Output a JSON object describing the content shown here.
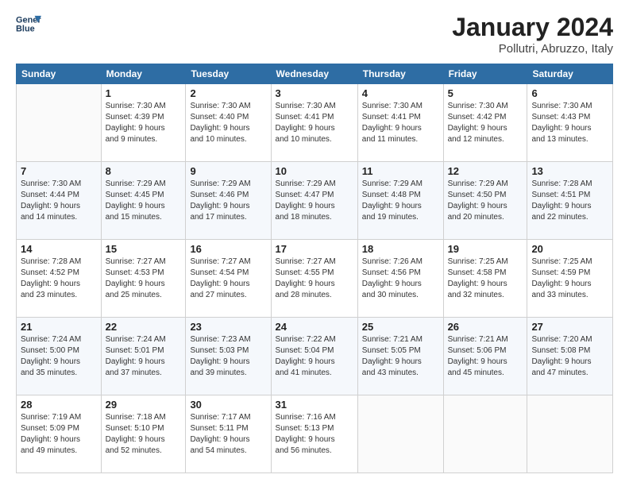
{
  "logo": {
    "line1": "General",
    "line2": "Blue"
  },
  "title": "January 2024",
  "location": "Pollutri, Abruzzo, Italy",
  "weekdays": [
    "Sunday",
    "Monday",
    "Tuesday",
    "Wednesday",
    "Thursday",
    "Friday",
    "Saturday"
  ],
  "weeks": [
    [
      {
        "day": "",
        "sunrise": "",
        "sunset": "",
        "daylight": ""
      },
      {
        "day": "1",
        "sunrise": "Sunrise: 7:30 AM",
        "sunset": "Sunset: 4:39 PM",
        "daylight": "Daylight: 9 hours and 9 minutes."
      },
      {
        "day": "2",
        "sunrise": "Sunrise: 7:30 AM",
        "sunset": "Sunset: 4:40 PM",
        "daylight": "Daylight: 9 hours and 10 minutes."
      },
      {
        "day": "3",
        "sunrise": "Sunrise: 7:30 AM",
        "sunset": "Sunset: 4:41 PM",
        "daylight": "Daylight: 9 hours and 10 minutes."
      },
      {
        "day": "4",
        "sunrise": "Sunrise: 7:30 AM",
        "sunset": "Sunset: 4:41 PM",
        "daylight": "Daylight: 9 hours and 11 minutes."
      },
      {
        "day": "5",
        "sunrise": "Sunrise: 7:30 AM",
        "sunset": "Sunset: 4:42 PM",
        "daylight": "Daylight: 9 hours and 12 minutes."
      },
      {
        "day": "6",
        "sunrise": "Sunrise: 7:30 AM",
        "sunset": "Sunset: 4:43 PM",
        "daylight": "Daylight: 9 hours and 13 minutes."
      }
    ],
    [
      {
        "day": "7",
        "sunrise": "Sunrise: 7:30 AM",
        "sunset": "Sunset: 4:44 PM",
        "daylight": "Daylight: 9 hours and 14 minutes."
      },
      {
        "day": "8",
        "sunrise": "Sunrise: 7:29 AM",
        "sunset": "Sunset: 4:45 PM",
        "daylight": "Daylight: 9 hours and 15 minutes."
      },
      {
        "day": "9",
        "sunrise": "Sunrise: 7:29 AM",
        "sunset": "Sunset: 4:46 PM",
        "daylight": "Daylight: 9 hours and 17 minutes."
      },
      {
        "day": "10",
        "sunrise": "Sunrise: 7:29 AM",
        "sunset": "Sunset: 4:47 PM",
        "daylight": "Daylight: 9 hours and 18 minutes."
      },
      {
        "day": "11",
        "sunrise": "Sunrise: 7:29 AM",
        "sunset": "Sunset: 4:48 PM",
        "daylight": "Daylight: 9 hours and 19 minutes."
      },
      {
        "day": "12",
        "sunrise": "Sunrise: 7:29 AM",
        "sunset": "Sunset: 4:50 PM",
        "daylight": "Daylight: 9 hours and 20 minutes."
      },
      {
        "day": "13",
        "sunrise": "Sunrise: 7:28 AM",
        "sunset": "Sunset: 4:51 PM",
        "daylight": "Daylight: 9 hours and 22 minutes."
      }
    ],
    [
      {
        "day": "14",
        "sunrise": "Sunrise: 7:28 AM",
        "sunset": "Sunset: 4:52 PM",
        "daylight": "Daylight: 9 hours and 23 minutes."
      },
      {
        "day": "15",
        "sunrise": "Sunrise: 7:27 AM",
        "sunset": "Sunset: 4:53 PM",
        "daylight": "Daylight: 9 hours and 25 minutes."
      },
      {
        "day": "16",
        "sunrise": "Sunrise: 7:27 AM",
        "sunset": "Sunset: 4:54 PM",
        "daylight": "Daylight: 9 hours and 27 minutes."
      },
      {
        "day": "17",
        "sunrise": "Sunrise: 7:27 AM",
        "sunset": "Sunset: 4:55 PM",
        "daylight": "Daylight: 9 hours and 28 minutes."
      },
      {
        "day": "18",
        "sunrise": "Sunrise: 7:26 AM",
        "sunset": "Sunset: 4:56 PM",
        "daylight": "Daylight: 9 hours and 30 minutes."
      },
      {
        "day": "19",
        "sunrise": "Sunrise: 7:25 AM",
        "sunset": "Sunset: 4:58 PM",
        "daylight": "Daylight: 9 hours and 32 minutes."
      },
      {
        "day": "20",
        "sunrise": "Sunrise: 7:25 AM",
        "sunset": "Sunset: 4:59 PM",
        "daylight": "Daylight: 9 hours and 33 minutes."
      }
    ],
    [
      {
        "day": "21",
        "sunrise": "Sunrise: 7:24 AM",
        "sunset": "Sunset: 5:00 PM",
        "daylight": "Daylight: 9 hours and 35 minutes."
      },
      {
        "day": "22",
        "sunrise": "Sunrise: 7:24 AM",
        "sunset": "Sunset: 5:01 PM",
        "daylight": "Daylight: 9 hours and 37 minutes."
      },
      {
        "day": "23",
        "sunrise": "Sunrise: 7:23 AM",
        "sunset": "Sunset: 5:03 PM",
        "daylight": "Daylight: 9 hours and 39 minutes."
      },
      {
        "day": "24",
        "sunrise": "Sunrise: 7:22 AM",
        "sunset": "Sunset: 5:04 PM",
        "daylight": "Daylight: 9 hours and 41 minutes."
      },
      {
        "day": "25",
        "sunrise": "Sunrise: 7:21 AM",
        "sunset": "Sunset: 5:05 PM",
        "daylight": "Daylight: 9 hours and 43 minutes."
      },
      {
        "day": "26",
        "sunrise": "Sunrise: 7:21 AM",
        "sunset": "Sunset: 5:06 PM",
        "daylight": "Daylight: 9 hours and 45 minutes."
      },
      {
        "day": "27",
        "sunrise": "Sunrise: 7:20 AM",
        "sunset": "Sunset: 5:08 PM",
        "daylight": "Daylight: 9 hours and 47 minutes."
      }
    ],
    [
      {
        "day": "28",
        "sunrise": "Sunrise: 7:19 AM",
        "sunset": "Sunset: 5:09 PM",
        "daylight": "Daylight: 9 hours and 49 minutes."
      },
      {
        "day": "29",
        "sunrise": "Sunrise: 7:18 AM",
        "sunset": "Sunset: 5:10 PM",
        "daylight": "Daylight: 9 hours and 52 minutes."
      },
      {
        "day": "30",
        "sunrise": "Sunrise: 7:17 AM",
        "sunset": "Sunset: 5:11 PM",
        "daylight": "Daylight: 9 hours and 54 minutes."
      },
      {
        "day": "31",
        "sunrise": "Sunrise: 7:16 AM",
        "sunset": "Sunset: 5:13 PM",
        "daylight": "Daylight: 9 hours and 56 minutes."
      },
      {
        "day": "",
        "sunrise": "",
        "sunset": "",
        "daylight": ""
      },
      {
        "day": "",
        "sunrise": "",
        "sunset": "",
        "daylight": ""
      },
      {
        "day": "",
        "sunrise": "",
        "sunset": "",
        "daylight": ""
      }
    ]
  ]
}
